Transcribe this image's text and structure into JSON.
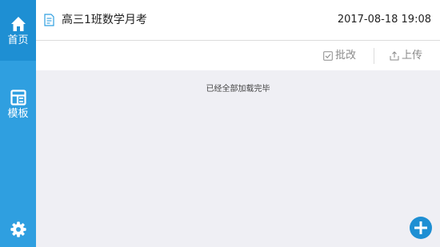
{
  "sidebar": {
    "items": [
      {
        "label": "首页",
        "icon": "home-icon",
        "active": true
      },
      {
        "label": "模板",
        "icon": "template-icon",
        "active": false
      }
    ],
    "settings_icon": "gear-icon"
  },
  "header": {
    "title": "高三1班数学月考",
    "title_icon": "document-icon",
    "datetime": "2017-08-18 19:08"
  },
  "toolbar": {
    "review_label": "批改",
    "review_icon": "checkbox-icon",
    "upload_label": "上传",
    "upload_icon": "upload-icon"
  },
  "content": {
    "status": "已经全部加载完毕"
  },
  "fab": {
    "icon": "plus-icon"
  },
  "colors": {
    "sidebar": "#2f9fe0",
    "sidebar_active": "#1e8fd3",
    "background": "#efeff4",
    "accent": "#1e8fd3"
  }
}
